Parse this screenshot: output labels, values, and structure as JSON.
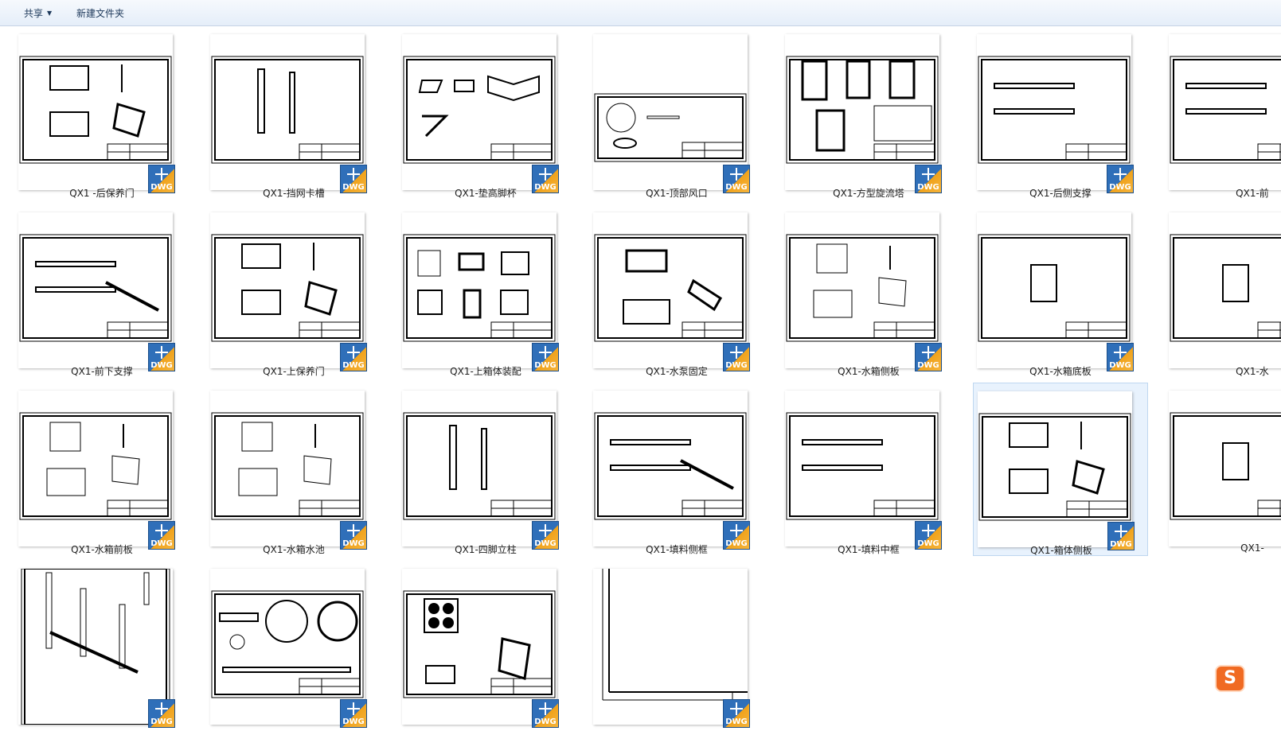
{
  "toolbar": {
    "share_label": "共享",
    "new_folder_label": "新建文件夹"
  },
  "badge_text": "DWG",
  "files": [
    {
      "label": "QX1 -后保养门",
      "kind": "door"
    },
    {
      "label": "QX1-挡网卡槽",
      "kind": "posts"
    },
    {
      "label": "QX1-垫高脚杯",
      "kind": "feet"
    },
    {
      "label": "QX1-顶部风口",
      "kind": "vent"
    },
    {
      "label": "QX1-方型旋流塔",
      "kind": "assembly"
    },
    {
      "label": "QX1-后侧支撑",
      "kind": "bars"
    },
    {
      "label": "QX1-前",
      "kind": "bars"
    },
    {
      "label": "QX1-前下支撑",
      "kind": "bars2"
    },
    {
      "label": "QX1-上保养门",
      "kind": "door2"
    },
    {
      "label": "QX1-上箱体装配",
      "kind": "box"
    },
    {
      "label": "QX1-水泵固定",
      "kind": "pump"
    },
    {
      "label": "QX1-水箱侧板",
      "kind": "panel"
    },
    {
      "label": "QX1-水箱底板",
      "kind": "plate"
    },
    {
      "label": "QX1-水",
      "kind": "plate2"
    },
    {
      "label": "QX1-水箱前板",
      "kind": "panel"
    },
    {
      "label": "QX1-水箱水池",
      "kind": "pool"
    },
    {
      "label": "QX1-四脚立柱",
      "kind": "columns"
    },
    {
      "label": "QX1-填料侧框",
      "kind": "frame"
    },
    {
      "label": "QX1-填料中框",
      "kind": "frame2"
    },
    {
      "label": "QX1-箱体侧板",
      "kind": "door",
      "selected": true
    },
    {
      "label": "QX1-",
      "kind": "plate2"
    },
    {
      "label": "",
      "kind": "closeup"
    },
    {
      "label": "",
      "kind": "fan"
    },
    {
      "label": "",
      "kind": "fans"
    },
    {
      "label": "",
      "kind": "blank"
    }
  ],
  "ime_icon": "sogou-ime-icon"
}
